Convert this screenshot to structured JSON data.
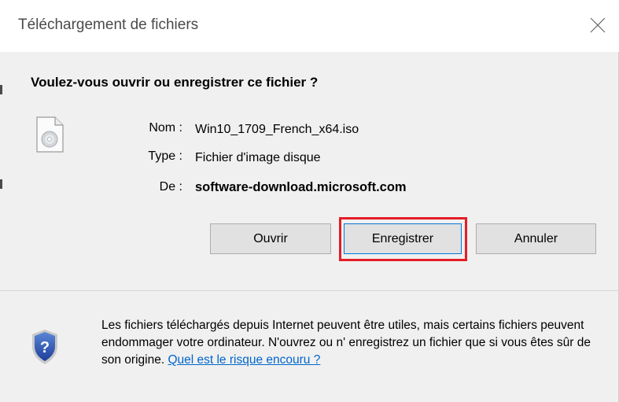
{
  "dialog": {
    "title": "Téléchargement de fichiers",
    "question": "Voulez-vous ouvrir ou enregistrer ce fichier ?"
  },
  "file": {
    "name_label": "Nom :",
    "name_value": "Win10_1709_French_x64.iso",
    "type_label": "Type :",
    "type_value": "Fichier d'image disque",
    "from_label": "De :",
    "from_value": "software-download.microsoft.com"
  },
  "buttons": {
    "open": "Ouvrir",
    "save": "Enregistrer",
    "cancel": "Annuler"
  },
  "warning": {
    "text": "Les fichiers téléchargés depuis Internet peuvent être utiles, mais certains fichiers peuvent endommager votre ordinateur. N'ouvrez ou n' enregistrez un fichier que si vous êtes sûr de son origine. ",
    "link": "Quel est le risque encouru ?"
  },
  "colors": {
    "highlight": "#e41d26",
    "link": "#0066cc",
    "default_button_border": "#0078d7"
  },
  "icons": {
    "file": "disc-image-file-icon",
    "close": "close-icon",
    "shield": "security-shield-question-icon"
  }
}
